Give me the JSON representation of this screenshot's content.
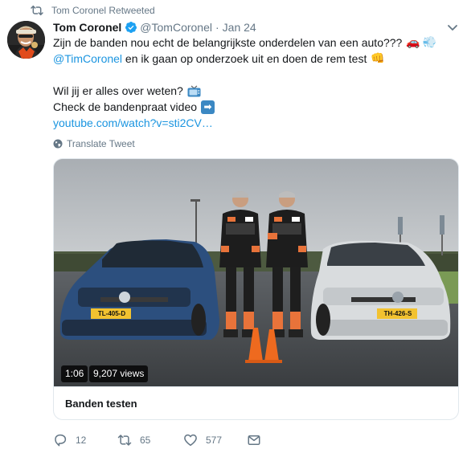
{
  "retweet_notice": {
    "text": "Tom Coronel Retweeted",
    "icon": "retweet-icon"
  },
  "tweet": {
    "author_name": "Tom Coronel",
    "verified": true,
    "handle": "@TomCoronel",
    "separator": "·",
    "date": "Jan 24",
    "lines": {
      "line1": "Zijn de banden nou echt de belangrijkste onderdelen van een auto???",
      "line1_emoji_car": "🚗",
      "line1_emoji_dash": "💨",
      "line2_mention": "@TimCoronel",
      "line2_text": " en ik gaan op onderzoek uit en doen de rem test",
      "line2_emoji_fist": "👊",
      "line3": "Wil jij er alles over weten?",
      "line4": "Check de bandenpraat video",
      "line4_emoji_arrow": "➡",
      "link": "youtube.com/watch?v=sti2CV…"
    },
    "translate_label": "Translate Tweet"
  },
  "card": {
    "duration": "1:06",
    "views": "9,207 views",
    "title": "Banden testen",
    "plates": {
      "left": "TL-405-D",
      "right": "TH-426-S"
    }
  },
  "actions": {
    "replies": "12",
    "retweets": "65",
    "likes": "577"
  },
  "colors": {
    "link": "#1b95e0",
    "muted": "#657786",
    "text": "#14171a",
    "border": "#e1e8ed",
    "verified": "#1da1f2"
  }
}
